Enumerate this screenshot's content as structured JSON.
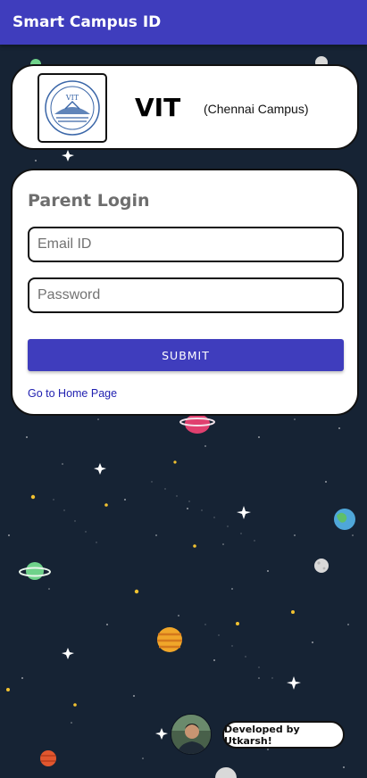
{
  "app_bar": {
    "title": "Smart Campus ID"
  },
  "header_card": {
    "logo_icon": "vit-crest-icon",
    "title": "VIT",
    "subtitle": "(Chennai Campus)"
  },
  "login": {
    "heading": "Parent Login",
    "email_placeholder": "Email ID",
    "email_value": "",
    "password_placeholder": "Password",
    "password_value": "",
    "submit_label": "SUBMIT",
    "home_link": "Go to Home Page"
  },
  "footer": {
    "developer_badge": "Developed by Utkarsh!",
    "avatar_icon": "developer-avatar"
  },
  "colors": {
    "primary": "#3f3dbd",
    "background": "#162334",
    "link": "#1f1fb0"
  }
}
